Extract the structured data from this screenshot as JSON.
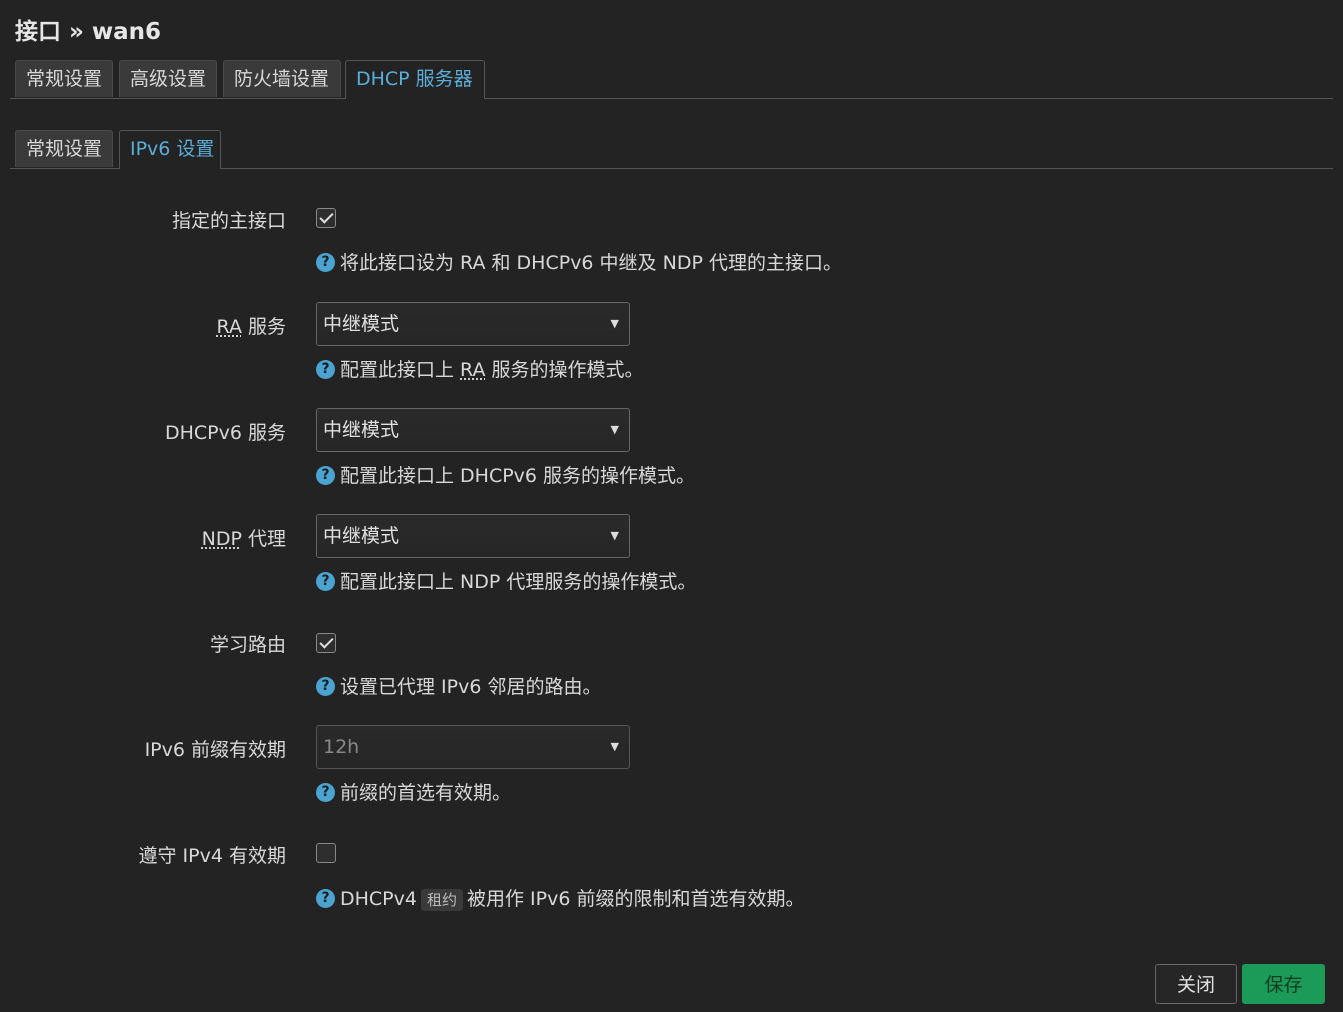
{
  "page": {
    "title": "接口 » wan6"
  },
  "main_tabs": [
    {
      "label": "常规设置",
      "active": false
    },
    {
      "label": "高级设置",
      "active": false
    },
    {
      "label": "防火墙设置",
      "active": false
    },
    {
      "label": "DHCP 服务器",
      "active": true
    }
  ],
  "sub_tabs": [
    {
      "label": "常规设置",
      "active": false
    },
    {
      "label": "IPv6 设置",
      "active": true
    }
  ],
  "fields": {
    "master": {
      "label": "指定的主接口",
      "checked": true,
      "help": "将此接口设为 RA 和 DHCPv6 中继及 NDP 代理的主接口。"
    },
    "ra": {
      "label_abbr": "RA",
      "label_rest": " 服务",
      "value": "中继模式",
      "help_before": "配置此接口上 ",
      "help_abbr": "RA",
      "help_after": " 服务的操作模式。"
    },
    "dhcpv6": {
      "label": "DHCPv6 服务",
      "value": "中继模式",
      "help": "配置此接口上 DHCPv6 服务的操作模式。"
    },
    "ndp": {
      "label_abbr": "NDP",
      "label_rest": " 代理",
      "value": "中继模式",
      "help": "配置此接口上 NDP 代理服务的操作模式。"
    },
    "learn_routes": {
      "label": "学习路由",
      "checked": true,
      "help": "设置已代理 IPv6 邻居的路由。"
    },
    "prefix_lifetime": {
      "label": "IPv6 前缀有效期",
      "value": "12h",
      "help": "前缀的首选有效期。"
    },
    "ipv4_lifetime": {
      "label": "遵守 IPv4 有效期",
      "checked": false,
      "help_before": "DHCPv4",
      "help_tag": "租约",
      "help_after": "被用作 IPv6 前缀的限制和首选有效期。"
    }
  },
  "buttons": {
    "close_label": "关闭",
    "save_label": "保存"
  },
  "icons": {
    "help": "help-question-icon",
    "dropdown": "caret-down-icon",
    "check": "checkmark-icon"
  },
  "colors": {
    "background": "#232323",
    "accent": "#5aaed8",
    "save_button": "#1c9a57"
  }
}
